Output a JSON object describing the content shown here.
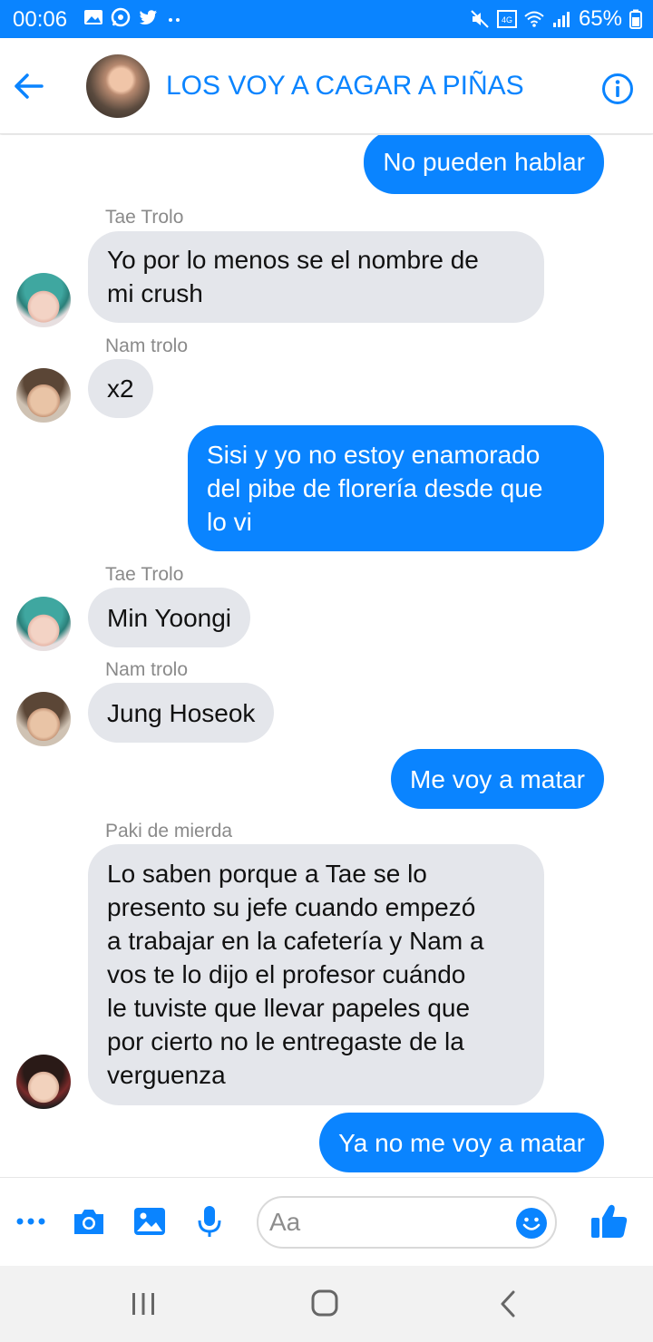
{
  "status_bar": {
    "time": "00:06",
    "battery": "65%",
    "icons_left": [
      "image-icon",
      "whatsapp-icon",
      "twitter-icon",
      "more-dots-icon"
    ],
    "icons_right": [
      "mute-icon",
      "volte-4g-icon",
      "wifi-icon",
      "signal-icon",
      "battery-icon"
    ]
  },
  "header": {
    "title": "LOS VOY A CAGAR A PIÑAS",
    "accent_color": "#0a84ff"
  },
  "messages": [
    {
      "id": "m1",
      "direction": "outgoing",
      "lines": [
        "No pueden hablar"
      ]
    },
    {
      "id": "m2",
      "direction": "incoming",
      "sender": "Tae Trolo",
      "lines": [
        "Yo por lo menos se el nombre de",
        "mi crush"
      ]
    },
    {
      "id": "m3",
      "direction": "incoming",
      "sender": "Nam trolo",
      "lines": [
        "x2"
      ]
    },
    {
      "id": "m4",
      "direction": "outgoing",
      "lines": [
        "Sisi y yo no estoy enamorado",
        "del pibe de florería desde que",
        "lo vi"
      ]
    },
    {
      "id": "m5",
      "direction": "incoming",
      "sender": "Tae Trolo",
      "lines": [
        "Min Yoongi"
      ]
    },
    {
      "id": "m6",
      "direction": "incoming",
      "sender": "Nam trolo",
      "lines": [
        "Jung Hoseok"
      ]
    },
    {
      "id": "m7",
      "direction": "outgoing",
      "lines": [
        "Me voy a matar"
      ]
    },
    {
      "id": "m8",
      "direction": "incoming",
      "sender": "Paki de mierda",
      "lines": [
        "Lo saben porque a Tae se lo",
        "presento su jefe cuando empezó",
        "a trabajar en la cafetería y Nam a",
        "vos te lo dijo el profesor cuándo",
        "le tuviste que llevar papeles que",
        "por cierto no le entregaste de la",
        "verguenza"
      ]
    },
    {
      "id": "m9",
      "direction": "outgoing",
      "lines": [
        "Ya no me voy a matar"
      ]
    }
  ],
  "composer": {
    "placeholder": "Aa",
    "icons": [
      "more-options-icon",
      "camera-icon",
      "gallery-icon",
      "microphone-icon",
      "emoji-icon",
      "like-icon"
    ]
  },
  "nav_bar": {
    "buttons": [
      "recent-apps-icon",
      "home-icon",
      "back-nav-icon"
    ]
  }
}
